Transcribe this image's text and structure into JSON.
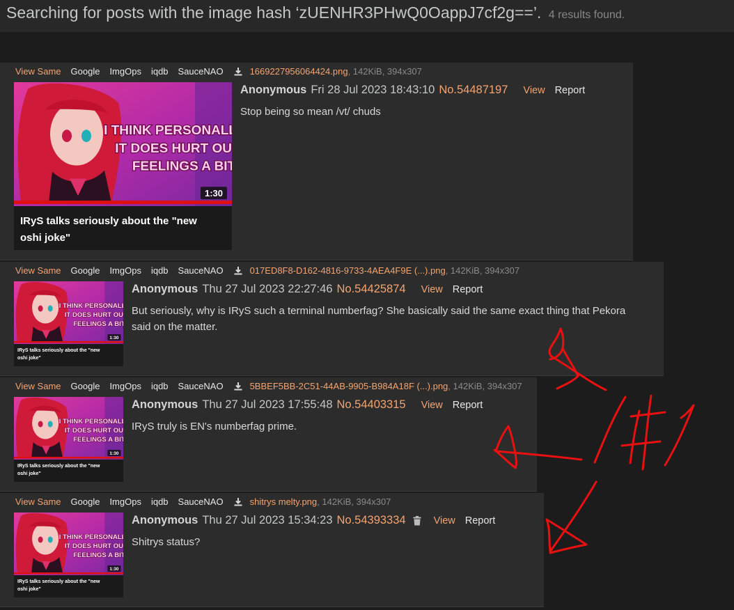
{
  "header": {
    "title": "Searching for posts with the image hash ‘zUENHR3PHwQ0OappJ7cf2g==’.",
    "result_count": "4 results found."
  },
  "file_actions": [
    "View Same",
    "Google",
    "ImgOps",
    "iqdb",
    "SauceNAO"
  ],
  "thumbnail": {
    "overlay_text": [
      "I THINK PERSONALLY",
      "IT DOES HURT OUR",
      "FEELINGS A BIT"
    ],
    "duration": "1:30",
    "caption_line1": "IRyS talks seriously about the \"new",
    "caption_line2": "oshi joke\""
  },
  "posts": [
    {
      "filename": "1669227956064424.png",
      "file_meta": ", 142KiB, 394x307",
      "name": "Anonymous",
      "date": "Fri 28 Jul 2023 18:43:10",
      "number": "No.54487197",
      "view": "View",
      "report": "Report",
      "body": "Stop being so mean /vt/ chuds",
      "deletable": false
    },
    {
      "filename": "017ED8F8-D162-4816-9733-4AEA4F9E (...).png",
      "file_meta": ", 142KiB, 394x307",
      "name": "Anonymous",
      "date": "Thu 27 Jul 2023 22:27:46",
      "number": "No.54425874",
      "view": "View",
      "report": "Report",
      "body": "But seriously, why is IRyS such a terminal numberfag? She basically said the same exact thing that Pekora said on the matter.",
      "deletable": false
    },
    {
      "filename": "5BBEF5BB-2C51-44AB-9905-B984A18F (...).png",
      "file_meta": ", 142KiB, 394x307",
      "name": "Anonymous",
      "date": "Thu 27 Jul 2023 17:55:48",
      "number": "No.54403315",
      "view": "View",
      "report": "Report",
      "body": "IRyS truly is EN's numberfag prime.",
      "deletable": false
    },
    {
      "filename": "shitrys melty.png",
      "file_meta": ", 142KiB, 394x307",
      "name": "Anonymous",
      "date": "Thu 27 Jul 2023 15:34:23",
      "number": "No.54393334",
      "view": "View",
      "report": "Report",
      "body": "Shitrys status?",
      "deletable": true
    }
  ],
  "colors": {
    "accent": "#f5a470",
    "background": "#1c1c1c",
    "post_background": "#2c2c2c",
    "annotation": "#e81010"
  }
}
